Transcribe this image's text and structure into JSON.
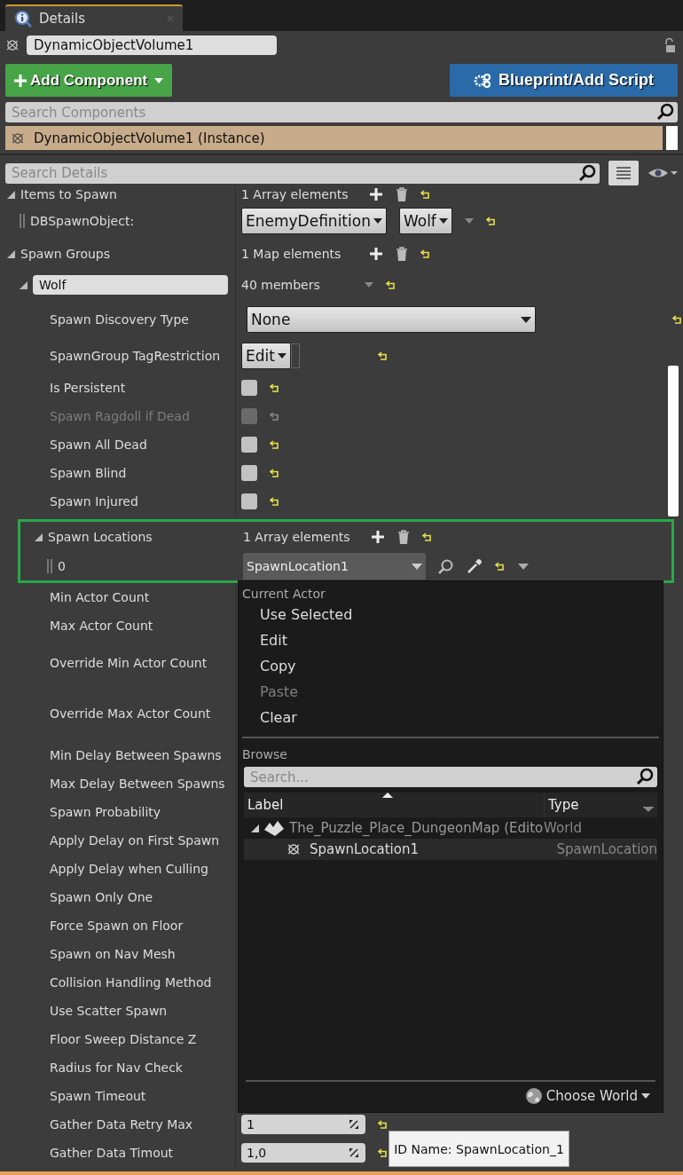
{
  "tab": {
    "label": "Details"
  },
  "actor_name": {
    "value": "DynamicObjectVolume1"
  },
  "toolbar": {
    "add_component": "Add Component",
    "blueprint": "Blueprint/Add Script"
  },
  "component_search": {
    "placeholder": "Search Components"
  },
  "components": [
    {
      "label": "DynamicObjectVolume1 (Instance)",
      "selected": true
    }
  ],
  "details_search": {
    "placeholder": "Search Details"
  },
  "properties": [
    {
      "kind": "array",
      "label": "Items to Spawn",
      "value": "1 Array elements",
      "expanded": true,
      "children": [
        {
          "kind": "object",
          "label": "DBSpawnObject:",
          "options": [
            "EnemyDefinition",
            "Wolf"
          ]
        }
      ]
    },
    {
      "kind": "array",
      "label": "Spawn Groups",
      "value": "1 Map elements",
      "expanded": true,
      "children": [
        {
          "kind": "key",
          "label": "Wolf",
          "value": "40 members",
          "expanded": true,
          "children": [
            {
              "kind": "combo",
              "label": "Spawn Discovery Type",
              "value": "None"
            },
            {
              "kind": "edit",
              "label": "SpawnGroup TagRestriction",
              "value": "Edit"
            },
            {
              "kind": "checkbox",
              "label": "Is Persistent",
              "checked": false,
              "disabled": false
            },
            {
              "kind": "checkbox",
              "label": "Spawn Ragdoll if Dead",
              "checked": false,
              "disabled": true
            },
            {
              "kind": "checkbox",
              "label": "Spawn All Dead",
              "checked": false,
              "disabled": false
            },
            {
              "kind": "checkbox",
              "label": "Spawn Blind",
              "checked": false,
              "disabled": false
            },
            {
              "kind": "checkbox",
              "label": "Spawn Injured",
              "checked": false,
              "disabled": false
            },
            {
              "kind": "array",
              "label": "Spawn Locations",
              "value": "1 Array elements",
              "expanded": true,
              "highlighted": true,
              "children": [
                {
                  "kind": "actor",
                  "label": "0",
                  "value": "SpawnLocation1"
                }
              ]
            },
            {
              "kind": "plain",
              "label": "Min Actor Count"
            },
            {
              "kind": "plain",
              "label": "Max Actor Count"
            },
            {
              "kind": "tall",
              "label": "Override Min Actor Count"
            },
            {
              "kind": "taller",
              "label": "Override Max Actor Count"
            },
            {
              "kind": "plain",
              "label": "Min Delay Between Spawns"
            },
            {
              "kind": "plain",
              "label": "Max Delay Between Spawns"
            },
            {
              "kind": "plain",
              "label": "Spawn Probability"
            },
            {
              "kind": "plain",
              "label": "Apply Delay on First Spawn"
            },
            {
              "kind": "plain",
              "label": "Apply Delay when Culling"
            },
            {
              "kind": "plain",
              "label": "Spawn Only One"
            },
            {
              "kind": "plain",
              "label": "Force Spawn on Floor"
            },
            {
              "kind": "plain",
              "label": "Spawn on Nav Mesh"
            },
            {
              "kind": "plain",
              "label": "Collision Handling Method"
            },
            {
              "kind": "plain",
              "label": "Use Scatter Spawn"
            },
            {
              "kind": "plain",
              "label": "Floor Sweep Distance Z"
            },
            {
              "kind": "plain",
              "label": "Radius for Nav Check"
            },
            {
              "kind": "plain",
              "label": "Spawn Timeout"
            },
            {
              "kind": "number",
              "label": "Gather Data Retry Max",
              "value": "1"
            },
            {
              "kind": "number",
              "label": "Gather Data Timout",
              "value": "1,0"
            }
          ]
        }
      ]
    }
  ],
  "picker": {
    "current_header": "Current Actor",
    "actions": [
      {
        "label": "Use Selected",
        "disabled": false
      },
      {
        "label": "Edit",
        "disabled": false
      },
      {
        "label": "Copy",
        "disabled": false
      },
      {
        "label": "Paste",
        "disabled": true
      },
      {
        "label": "Clear",
        "disabled": false
      }
    ],
    "browse_header": "Browse",
    "search": {
      "placeholder": "Search..."
    },
    "columns": [
      "Label",
      "Type"
    ],
    "tree": [
      {
        "label": "The_Puzzle_Place_DungeonMap (Edito",
        "type": "World",
        "expanded": true,
        "selected": false,
        "children": [
          {
            "label": "SpawnLocation1",
            "type": "SpawnLocation",
            "selected": true
          }
        ]
      }
    ],
    "footer": "Choose World"
  },
  "tooltip": "ID Name: SpawnLocation_1"
}
